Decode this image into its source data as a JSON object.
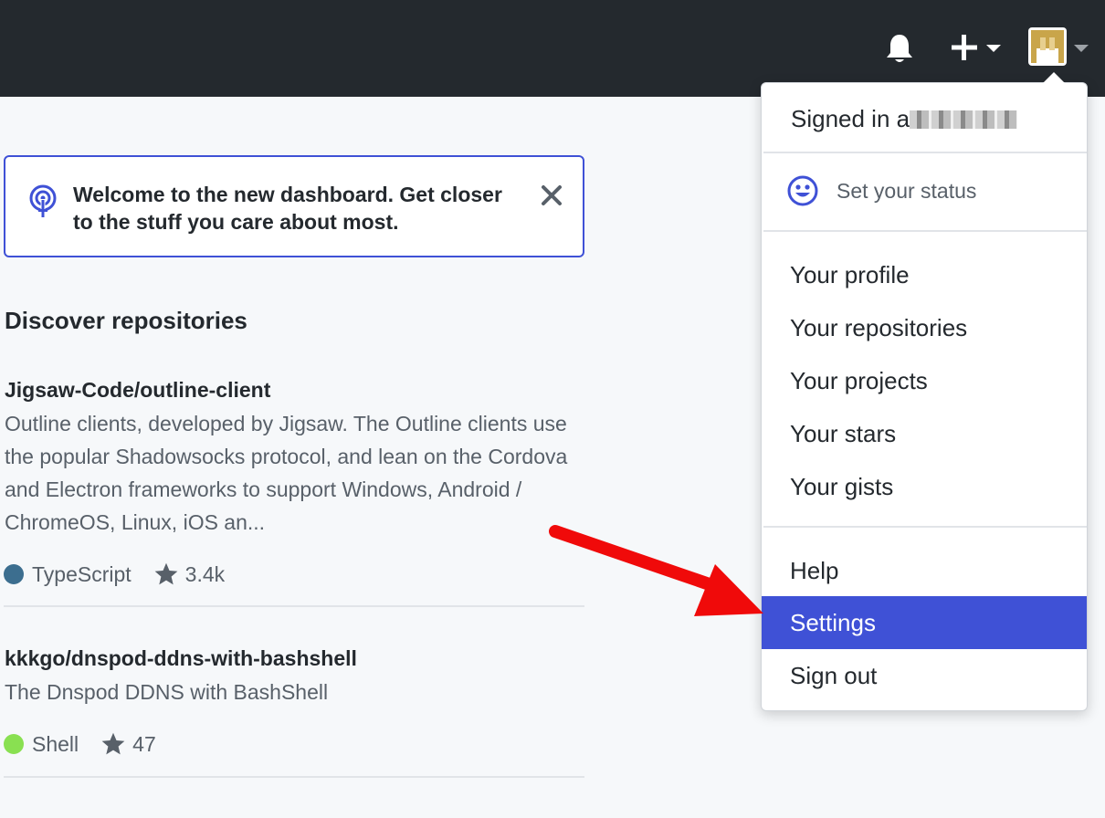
{
  "header": {
    "notifications_icon": "bell-icon",
    "create_icon": "plus-icon",
    "avatar_icon": "user-avatar"
  },
  "banner": {
    "text": "Welcome to the new dashboard. Get closer to the stuff you care about most.",
    "icon": "broadcast-icon",
    "close_icon": "close-icon",
    "accent_color": "#3f51d6"
  },
  "discover": {
    "title": "Discover repositories",
    "repos": [
      {
        "name": "Jigsaw-Code/outline-client",
        "description": "Outline clients, developed by Jigsaw. The Outline clients use the popular Shadowsocks protocol, and lean on the Cordova and Electron frameworks to support Windows, Android / ChromeOS, Linux, iOS an...",
        "language": "TypeScript",
        "language_color": "#2b7489",
        "stars": "3.4k"
      },
      {
        "name": "kkkgo/dnspod-ddns-with-bashshell",
        "description": "The Dnspod DDNS with BashShell",
        "language": "Shell",
        "language_color": "#89e051",
        "stars": "47"
      }
    ]
  },
  "dropdown": {
    "signed_in": "Signed in a",
    "status": "Set your status",
    "status_icon": "smiley-icon",
    "profile_items": [
      "Your profile",
      "Your repositories",
      "Your projects",
      "Your stars",
      "Your gists"
    ],
    "help": "Help",
    "settings": "Settings",
    "sign_out": "Sign out",
    "highlight_color": "#3f51d6"
  },
  "annotation": {
    "arrow_color": "#f00a0a"
  }
}
